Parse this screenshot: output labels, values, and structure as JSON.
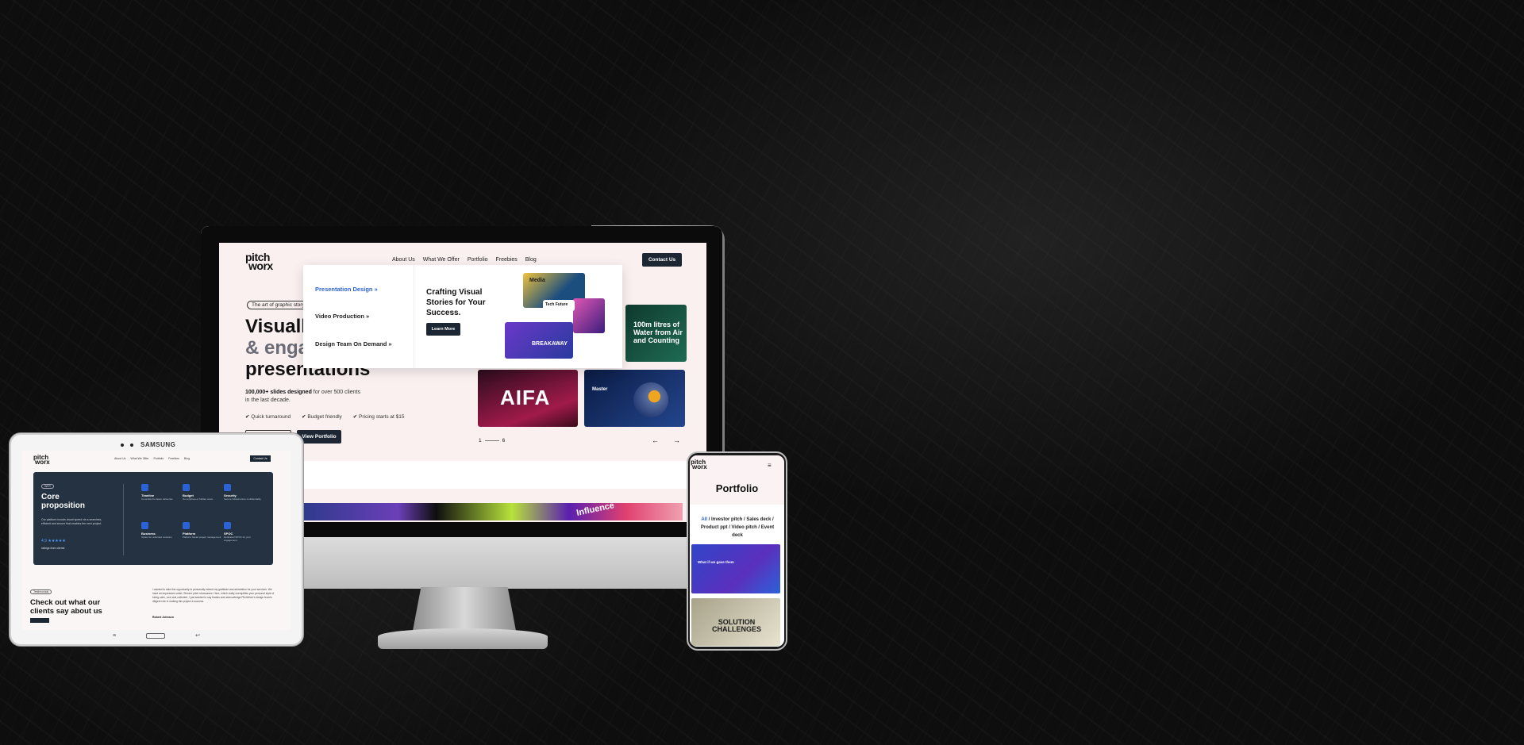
{
  "colors": {
    "accent": "#2b62d6",
    "dark_button": "#1d2733",
    "screen_bg": "#faf0f0"
  },
  "desktop": {
    "logo_line1": "pitch",
    "logo_line2": "worx",
    "nav": [
      "About Us",
      "What We Offer",
      "Portfolio",
      "Freebies",
      "Blog"
    ],
    "contact": "Contact Us",
    "tag": "The art of graphic story",
    "heading_line1": "Visuall",
    "heading_line2": "& enga",
    "heading_line3": "presentations",
    "desc_bold": "100,000+ slides designed",
    "desc_rest": " for over 500 clients in the last decade.",
    "checks": [
      "Quick turnaround",
      "Budget friendly",
      "Pricing starts at $15"
    ],
    "view_portfolio": "View Portfolio",
    "mega_menu": {
      "items": [
        "Presentation Design »",
        "Video Production »",
        "Design Team On Demand »"
      ],
      "title": "Crafting Visual Stories for Your Success.",
      "button": "Learn More"
    },
    "thumbs": {
      "yellow": "Media",
      "tech": "Tech Future",
      "breakaway": "BREAKAWAY",
      "green": "100m litres of Water from Air and Counting",
      "aifa": "AIFA",
      "blue": "Master"
    },
    "pager_start": "1",
    "pager_end": "6",
    "arrow_prev": "←",
    "arrow_next": "→",
    "banner_text": "Influence"
  },
  "tablet": {
    "brand": "SAMSUNG",
    "logo_line1": "pitch",
    "logo_line2": "worx",
    "nav": [
      "About Us",
      "What We Offer",
      "Portfolio",
      "Freebies",
      "Blog"
    ],
    "contact": "Contact Us",
    "badge": "WHY",
    "core_title": "Core proposition",
    "core_desc": "Our platform boosts visual speed via a seamless, efficient and secure that enables the next project.",
    "stars": "4.9 ★★★★★",
    "ratings": "ratings from clients",
    "features": [
      {
        "title": "Timeline",
        "desc": "Committed to faster deliveries"
      },
      {
        "title": "Budget",
        "desc": "No surprises or hidden costs"
      },
      {
        "title": "Security",
        "desc": "Secure infrastructure confidentiality"
      },
      {
        "title": "Business",
        "desc": "Option for unlimited revisions"
      },
      {
        "title": "Platform",
        "desc": "Platform based project management"
      },
      {
        "title": "SPOC",
        "desc": "Dedicated SPOC for your engagement"
      }
    ],
    "test_badge": "Testimonials",
    "check_title": "Check out what our clients say about us",
    "quote": "I wanted to take this opportunity to personally extend my gratitude and admiration for your services. We have an impressive outlet. Sincere pitch showcases. Here, which really exemplifies your personal style of being calm, cool and collected. I just wanted to say thanks and acknowledge PitchWorx's design team's diligent role in making this project a success.",
    "quote_name": "Robert Johnson",
    "nav_back": "⌐",
    "nav_recent": "≡",
    "nav_return": "↩"
  },
  "phone": {
    "logo_line1": "pitch",
    "logo_line2": "worx",
    "menu_icon": "≡",
    "title": "Portfolio",
    "filter_all": "All",
    "filters_rest": " / Investor pitch / Sales deck / Product ppt / Video pitch / Event deck",
    "card1_title": "What if we gave them",
    "card2_line1": "SOLUTION",
    "card2_line2": "CHALLENGES"
  }
}
